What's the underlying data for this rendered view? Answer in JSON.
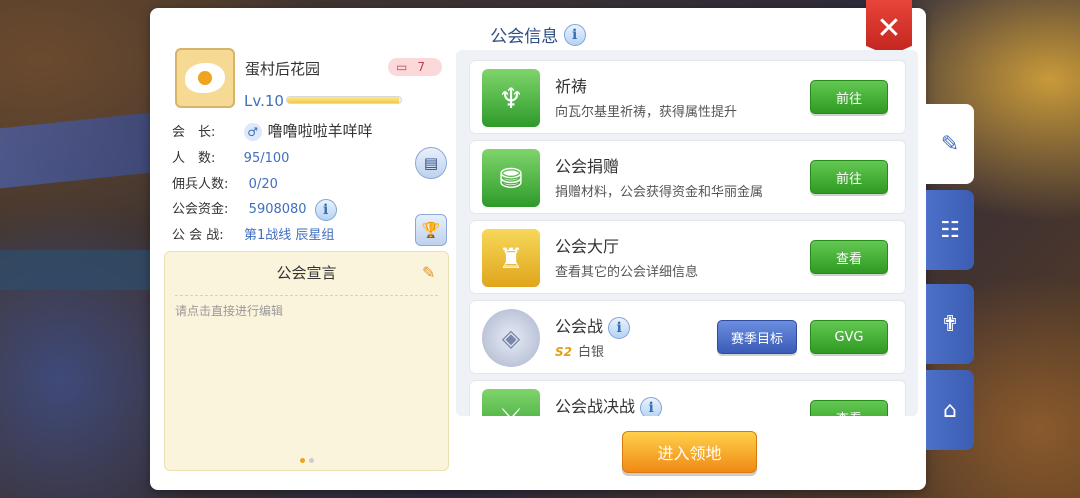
{
  "window": {
    "title": "公会信息",
    "close_label": "✕"
  },
  "guild": {
    "name": "蛋村后花园",
    "member_badge_count": "7",
    "level": "Lv.10",
    "level_progress": 0.98,
    "leader_label": "会　长:",
    "leader_value": "噜噜啦啦羊咩咩",
    "members_label": "人　数:",
    "members_value": "95/100",
    "mercenary_label": "佣兵人数:",
    "mercenary_value": "0/20",
    "funds_label": "公会资金:",
    "funds_value": "5908080",
    "war_label": "公 会 战:",
    "war_value": "第1战线  辰星组"
  },
  "manifesto": {
    "title": "公会宣言",
    "hint": "请点击直接进行编辑"
  },
  "activities": [
    {
      "title": "祈祷",
      "desc": "向瓦尔基里祈祷，获得属性提升",
      "button": "前往",
      "icon": "pray-icon",
      "color": "#3fb14a"
    },
    {
      "title": "公会捐赠",
      "desc": "捐赠材料，公会获得资金和华丽金属",
      "button": "前往",
      "icon": "donate-icon",
      "color": "#3fb14a"
    },
    {
      "title": "公会大厅",
      "desc": "查看其它的公会详细信息",
      "button": "查看",
      "icon": "castle-icon",
      "color": "#e8b629"
    },
    {
      "title": "公会战",
      "season": "S2",
      "rank": "白银",
      "button_secondary": "赛季目标",
      "button": "GVG",
      "icon": "silver-emblem-icon",
      "color": "#b4bdd3"
    },
    {
      "title": "公会战决战",
      "button": "查看",
      "icon": "crossed-swords-icon",
      "color": "#3fb14a"
    }
  ],
  "enter_button": "进入领地",
  "side_tabs": [
    {
      "icon": "edit-icon",
      "active": true
    },
    {
      "icon": "contacts-book-icon",
      "active": false
    },
    {
      "icon": "church-icon",
      "active": false
    },
    {
      "icon": "home-icon",
      "active": false
    }
  ]
}
